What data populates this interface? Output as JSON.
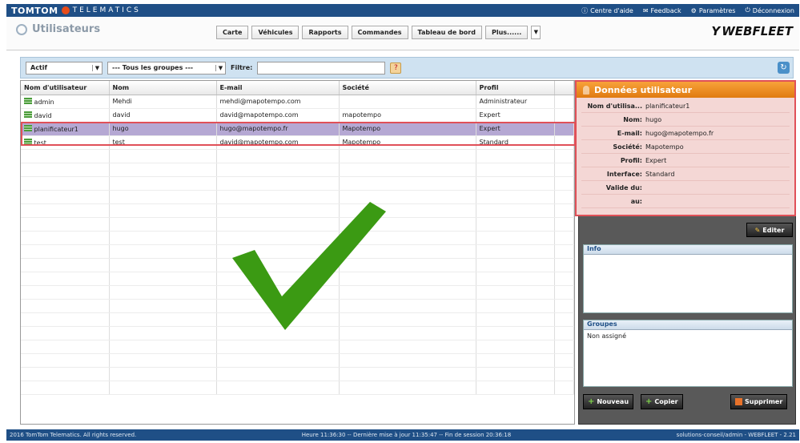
{
  "brand": {
    "name": "TOMTOM",
    "sub": "TELEMATICS"
  },
  "toplinks": [
    {
      "icon": "help-icon",
      "label": "Centre d'aide"
    },
    {
      "icon": "feedback-icon",
      "label": "Feedback"
    },
    {
      "icon": "settings-icon",
      "label": "Paramètres"
    },
    {
      "icon": "logout-icon",
      "label": "Déconnexion"
    }
  ],
  "header": {
    "title": "Utilisateurs",
    "tabs": [
      "Carte",
      "Véhicules",
      "Rapports",
      "Commandes",
      "Tableau de bord",
      "Plus......"
    ],
    "logo": "WEBFLEET"
  },
  "filter": {
    "status": "Actif",
    "group": "--- Tous les groupes ---",
    "filter_label": "Filtre:",
    "filter_value": ""
  },
  "table": {
    "columns": [
      "Nom d'utilisateur",
      "Nom",
      "E-mail",
      "Société",
      "Profil"
    ],
    "rows": [
      {
        "username": "admin",
        "name": "Mehdi",
        "email": "mehdi@mapotempo.com",
        "company": "",
        "profile": "Administrateur"
      },
      {
        "username": "david",
        "name": "david",
        "email": "david@mapotempo.com",
        "company": "mapotempo",
        "profile": "Expert"
      },
      {
        "username": "planificateur1",
        "name": "hugo",
        "email": "hugo@mapotempo.fr",
        "company": "Mapotempo",
        "profile": "Expert"
      },
      {
        "username": "test",
        "name": "test",
        "email": "david@mapotempo.com",
        "company": "Mapotempo",
        "profile": "Standard"
      }
    ],
    "selected_index": 2
  },
  "user_data": {
    "title": "Données utilisateur",
    "fields": [
      {
        "label": "Nom d'utilisa...",
        "value": "planificateur1"
      },
      {
        "label": "Nom:",
        "value": "hugo"
      },
      {
        "label": "E-mail:",
        "value": "hugo@mapotempo.fr"
      },
      {
        "label": "Société:",
        "value": "Mapotempo"
      },
      {
        "label": "Profil:",
        "value": "Expert"
      },
      {
        "label": "Interface:",
        "value": "Standard"
      },
      {
        "label": "Valide du:",
        "value": ""
      },
      {
        "label": "au:",
        "value": ""
      }
    ],
    "edit_label": "Editer"
  },
  "info": {
    "title": "Info",
    "body": ""
  },
  "groups": {
    "title": "Groupes",
    "body": "Non assigné"
  },
  "actions": {
    "new_label": "Nouveau",
    "copy_label": "Copier",
    "delete_label": "Supprimer"
  },
  "status": {
    "left": "2016 TomTom Telematics. All rights reserved.",
    "center": "Heure 11:36:30 -- Dernière mise à jour 11:35:47 -- Fin de session 20:36:18",
    "right": "solutions-conseil/admin - WEBFLEET - 2.21"
  },
  "colors": {
    "topbar": "#1f4f86",
    "accent": "#e07a10",
    "highlight": "#e05058",
    "check": "#3b9a13"
  }
}
